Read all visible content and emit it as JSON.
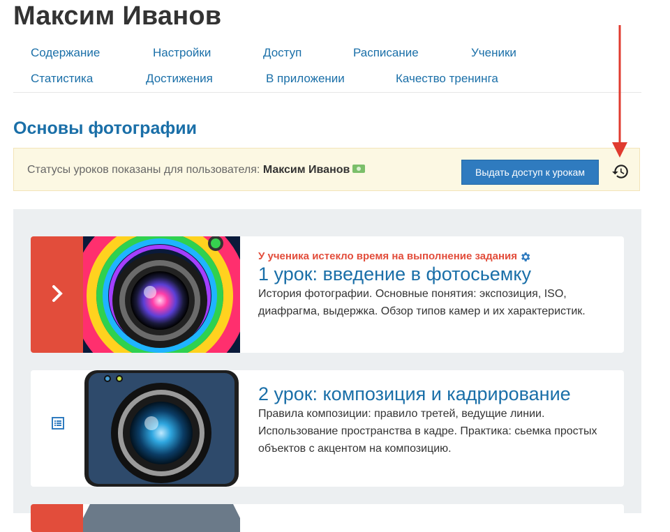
{
  "header": {
    "title": "Максим Иванов"
  },
  "nav": {
    "row1": [
      "Содержание",
      "Настройки",
      "Доступ",
      "Расписание",
      "Ученики"
    ],
    "row2": [
      "Статистика",
      "Достижения",
      "В приложении",
      "Качество тренинга"
    ]
  },
  "course": {
    "title": "Основы фотографии"
  },
  "status": {
    "prefix": "Статусы уроков показаны для пользователя: ",
    "user": "Максим Иванов",
    "button": "Выдать доступ к урокам"
  },
  "lessons": [
    {
      "warning": "У ученика истекло время на выполнение задания",
      "title": "1 урок: введение в фотосьемку",
      "description": "История фотографии. Основные понятия: экспозиция, ISO, диафрагма, выдержка. Обзор типов камер и их характеристик.",
      "side_color": "#e24d3b",
      "side_icon": "chevron-right-icon"
    },
    {
      "warning": "",
      "title": "2 урок: композиция и кадрирование",
      "description": "Правила композиции: правило третей, ведущие линии. Использование пространства в кадре. Практика: сьемка простых объектов с акцентом на композицию.",
      "side_color": "#ffffff",
      "side_icon": "list-icon"
    }
  ],
  "colors": {
    "accent": "#1a6fa8",
    "danger": "#e24d3b",
    "annotation_arrow": "#e03b2f"
  }
}
